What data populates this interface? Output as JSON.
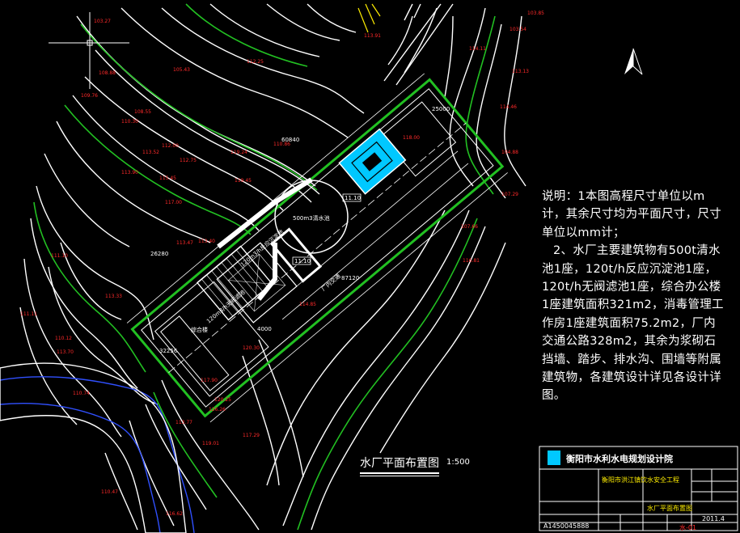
{
  "notes": {
    "line1": "说明：1本图高程尺寸单位以m计，其余尺寸均为平面尺寸，尺寸单位以mm计；",
    "line2": "2、水厂主要建筑物有500t清水池1座，120t/h反应沉淀池1座，120t/h无阀滤池1座，综合办公楼1座建筑面积321m2，消毒管理工作房1座建筑面积75.2m2，厂内交通公路328m2，其余为浆砌石挡墙、踏步、排水沟、围墙等附属建筑物，各建筑设计详见各设计详图。"
  },
  "plan_title": "水厂平面布置图",
  "plan_scale": "1:500",
  "title_block": {
    "org": "衡阳市水利水电规划设计院",
    "project": "衡阳市洪江镇饮水安全工程",
    "drawing": "水厂平面布置图",
    "cert_no": "A1450045888",
    "date": "2011.4",
    "sheet": "水-01"
  },
  "dimensions": {
    "d25000": "25000",
    "d60840": "60840",
    "d26280": "26280",
    "d87120": "87120",
    "d32256": "32256",
    "d4000": "4000"
  },
  "structure_labels": {
    "reservoir": "500m3清水池",
    "sediment": "120m3/h反应沉淀池",
    "filter": "120m3/h无阀滤池",
    "road": "厂内交通",
    "sign1": "11.10",
    "sign2": "11.10",
    "office": "综合楼"
  },
  "elevations": [
    {
      "t": "103.27"
    },
    {
      "t": "103.54"
    },
    {
      "t": "103.85"
    },
    {
      "t": "108.88"
    },
    {
      "t": "109.76"
    },
    {
      "t": "108.55"
    },
    {
      "t": "110.30"
    },
    {
      "t": "112.00"
    },
    {
      "t": "112.75"
    },
    {
      "t": "113.52"
    },
    {
      "t": "115.45"
    },
    {
      "t": "113.90"
    },
    {
      "t": "117.00"
    },
    {
      "t": "119.24"
    },
    {
      "t": "110.86"
    },
    {
      "t": "113.40"
    },
    {
      "t": "113.47"
    },
    {
      "t": "104.88"
    },
    {
      "t": "107.29"
    },
    {
      "t": "107.66"
    },
    {
      "t": "114.46"
    },
    {
      "t": "111.10"
    },
    {
      "t": "111.11"
    },
    {
      "t": "110.12"
    },
    {
      "t": "113.33"
    },
    {
      "t": "113.70"
    },
    {
      "t": "110.47"
    },
    {
      "t": "110.74"
    },
    {
      "t": "113.77"
    },
    {
      "t": "116.62"
    },
    {
      "t": "120.25"
    },
    {
      "t": "126.26"
    },
    {
      "t": "119.01"
    },
    {
      "t": "114.85"
    },
    {
      "t": "117.29"
    },
    {
      "t": "118.00"
    },
    {
      "t": "119.45"
    },
    {
      "t": "120.30"
    },
    {
      "t": "116.81"
    },
    {
      "t": "113.13"
    },
    {
      "t": "114.11"
    },
    {
      "t": "113.91"
    },
    {
      "t": "117.90"
    },
    {
      "t": "105.43"
    },
    {
      "t": "112.25"
    }
  ]
}
